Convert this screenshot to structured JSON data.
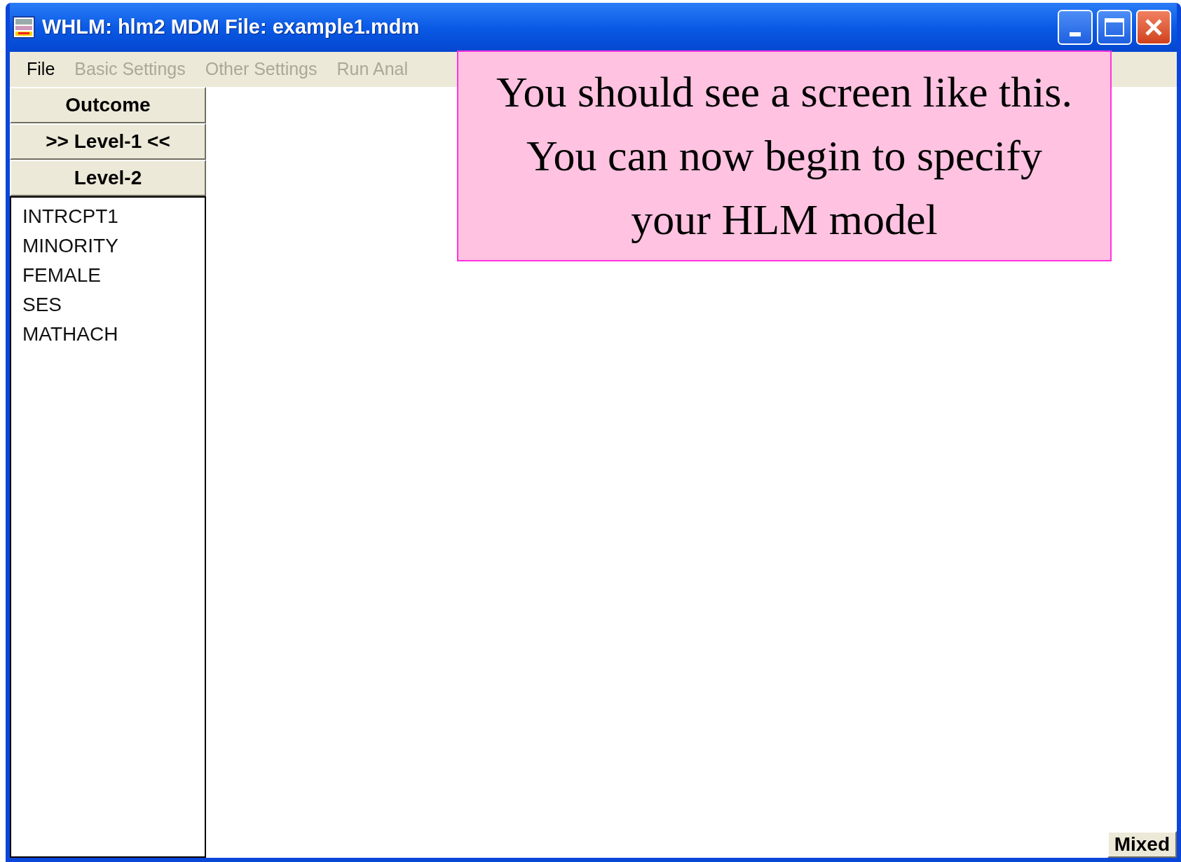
{
  "window": {
    "title": "WHLM: hlm2 MDM File: example1.mdm"
  },
  "menu": [
    {
      "label": "File",
      "disabled": false
    },
    {
      "label": "Basic Settings",
      "disabled": true
    },
    {
      "label": "Other Settings",
      "disabled": true
    },
    {
      "label": "Run Anal",
      "disabled": true
    }
  ],
  "sidebar": {
    "buttons": [
      "Outcome",
      ">> Level-1 <<",
      "Level-2"
    ],
    "variables": [
      "INTRCPT1",
      "MINORITY",
      "FEMALE",
      "SES",
      "MATHACH"
    ]
  },
  "status_button": "Mixed",
  "callout": {
    "text": "You should see a screen like this.  You can now begin to specify your HLM model"
  }
}
